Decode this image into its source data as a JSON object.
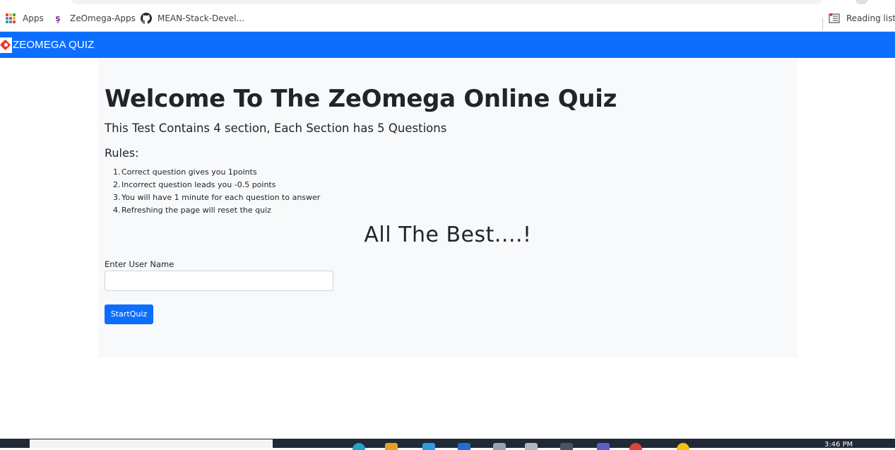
{
  "bookmarks": {
    "apps_label": "Apps",
    "items": [
      {
        "label": "ZeOmega-Apps"
      },
      {
        "label": "MEAN-Stack-Devel..."
      }
    ],
    "reading_list_label": "Reading list"
  },
  "navbar": {
    "brand": "ZEOMEGA QUIZ"
  },
  "main": {
    "title": "Welcome To The ZeOmega Online Quiz",
    "lead": "This Test Contains 4 section, Each Section has 5 Questions",
    "rules_title": "Rules:",
    "rules": [
      {
        "num": "1.",
        "text": "Correct question gives you 1points"
      },
      {
        "num": "2.",
        "text": "Incorrect question leads you -0.5 points"
      },
      {
        "num": "3.",
        "text": "You will have 1 minute for each question to answer"
      },
      {
        "num": "4.",
        "text": "Refreshing the page will reset the quiz"
      }
    ],
    "wish": "All The Best....!",
    "username_label": "Enter User Name",
    "username_value": "",
    "start_button": "StartQuiz"
  },
  "taskbar": {
    "clock": "3:46 PM"
  },
  "colors": {
    "primary": "#0d6efd",
    "jumbotron_bg": "#f8f9fa",
    "text": "#212529"
  },
  "icons": [
    "apps-grid-icon",
    "zeomega-favicon-icon",
    "github-icon",
    "reading-list-icon",
    "zeomega-logo-icon"
  ]
}
